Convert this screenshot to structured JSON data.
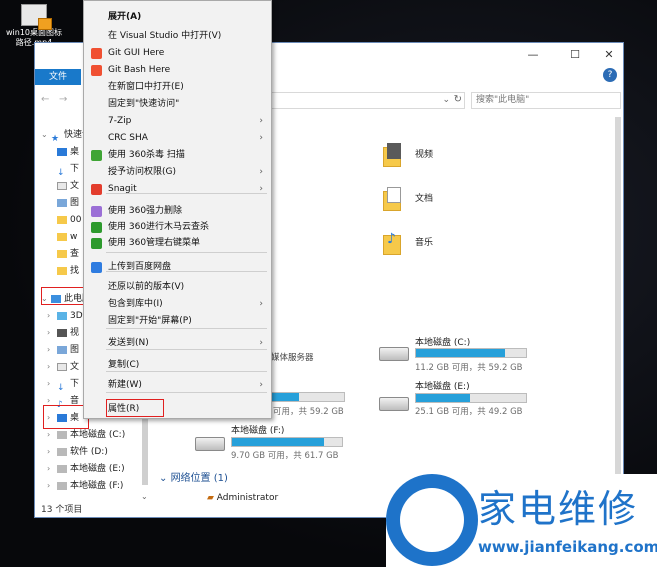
{
  "desktop": {
    "icon_label": "win10桌面图标路径.mp4"
  },
  "explorer": {
    "file_tab": "文件",
    "help": "?",
    "search_placeholder": "搜索\"此电脑\"",
    "status": "13 个项目",
    "nav": {
      "quick_access": "快速访问",
      "short_items": [
        "桌",
        "下",
        "文",
        "图",
        "00",
        "w",
        "查",
        "找"
      ],
      "this_pc": "此电脑",
      "pc_children_short": [
        "3D",
        "视",
        "图",
        "文",
        "下",
        "音",
        "桌"
      ],
      "drives": [
        "本地磁盘 (C:)",
        "软件 (D:)",
        "本地磁盘 (E:)",
        "本地磁盘 (F:)"
      ]
    },
    "folders": [
      {
        "name": "视频",
        "color": "#f6c94a"
      },
      {
        "name": "文档",
        "color": "#f6c94a"
      },
      {
        "name": "音乐",
        "color": "#f6c94a"
      }
    ],
    "drives_view": [
      {
        "name": "本地磁盘 (C:)",
        "free": "11.2 GB 可用，共 59.2 GB",
        "used_fraction": 0.81
      },
      {
        "name": "本地磁盘 (E:)",
        "free": "25.1 GB 可用，共 49.2 GB",
        "used_fraction": 0.49
      },
      {
        "name": "",
        "free": "可用，共 59.2 GB",
        "used_fraction": 0.6
      },
      {
        "name": "本地磁盘 (F:)",
        "free": "9.70 GB 可用，共 61.7 GB",
        "used_fraction": 0.84
      }
    ],
    "partial_label": "媒体服务器",
    "network_header": "网络位置 (1)",
    "network_item": "Administrator"
  },
  "context_menu": {
    "items": [
      {
        "label": "展开(A)",
        "bold": true
      },
      {
        "label": "在 Visual Studio 中打开(V)"
      },
      {
        "label": "Git GUI Here",
        "icon": "git-icon"
      },
      {
        "label": "Git Bash Here",
        "icon": "git-icon"
      },
      {
        "label": "在新窗口中打开(E)"
      },
      {
        "label": "固定到\"快速访问\""
      },
      {
        "label": "7-Zip",
        "submenu": true
      },
      {
        "label": "CRC SHA",
        "submenu": true
      },
      {
        "label": "使用 360杀毒 扫描",
        "icon": "shield-icon"
      },
      {
        "label": "授予访问权限(G)",
        "submenu": true
      },
      {
        "label": "Snagit",
        "icon": "snagit-icon",
        "submenu": true
      },
      {
        "label": "使用 360强力删除",
        "icon": "purple-icon"
      },
      {
        "label": "使用 360进行木马云查杀",
        "icon": "360-icon"
      },
      {
        "label": "使用 360管理右键菜单",
        "icon": "360-icon"
      },
      {
        "label": "上传到百度网盘",
        "icon": "cloud-icon"
      },
      {
        "label": "还原以前的版本(V)"
      },
      {
        "label": "包含到库中(I)",
        "submenu": true
      },
      {
        "label": "固定到\"开始\"屏幕(P)"
      },
      {
        "label": "发送到(N)",
        "submenu": true
      },
      {
        "label": "复制(C)"
      },
      {
        "label": "新建(W)",
        "submenu": true
      },
      {
        "label": "属性(R)"
      }
    ]
  },
  "watermark": {
    "title": "家电维修",
    "url": "www.jianfeikang.com"
  },
  "colors": {
    "accent": "#1979ca",
    "highlight_box": "#e02020",
    "drive_bar": "#26a0da"
  }
}
